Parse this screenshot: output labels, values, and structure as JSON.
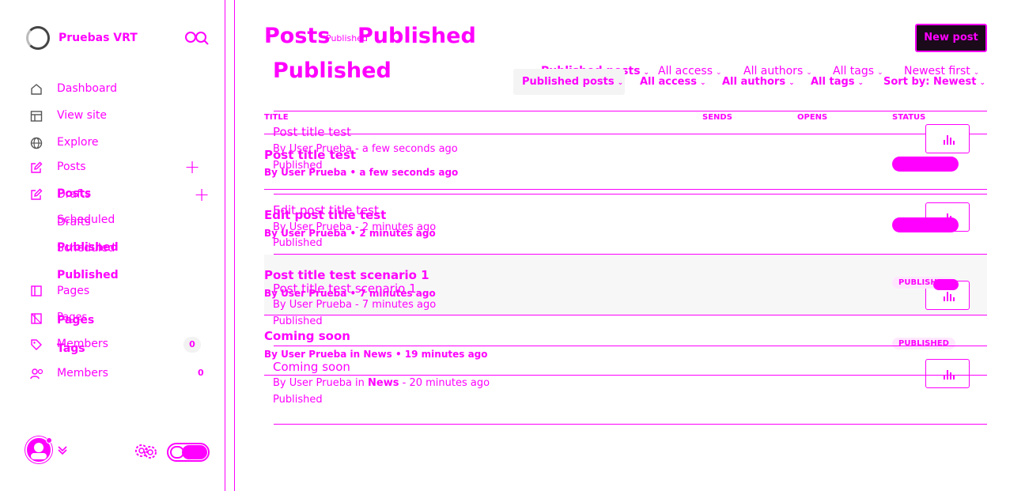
{
  "app": {
    "site_name": "Pruebas VRT",
    "brand_color": "#ff00ff"
  },
  "sidebar": {
    "items": [
      {
        "label": "Dashboard",
        "icon": "home-icon"
      },
      {
        "label": "View site",
        "icon": "browser-icon"
      },
      {
        "label": "Explore",
        "icon": "globe-icon"
      },
      {
        "label": "Posts",
        "icon": "edit-icon"
      },
      {
        "label": "Posts",
        "icon": "edit-icon"
      }
    ],
    "sub_items": [
      "Drafts",
      "Drafts",
      "Scheduled",
      "Scheduled",
      "Published",
      "Published",
      "Published"
    ],
    "pages_label": "Pages",
    "pages_label_2": "Pages",
    "pages_label_3": "Pages",
    "tags_label": "Tags",
    "members_label": "Members",
    "members_label_2": "Members",
    "members_count": "0",
    "members_count_2": "0"
  },
  "header": {
    "title_a": "Posts",
    "title_sub": "Published",
    "title_b": "Published",
    "title_c": "Published",
    "new_post": "New post"
  },
  "filters": {
    "row1": [
      "Published posts",
      "All access",
      "All authors",
      "All tags",
      "Newest first"
    ],
    "row2": [
      "Published posts",
      "All access",
      "All authors",
      "All tags",
      "Sort by: Newest"
    ]
  },
  "table": {
    "columns": [
      "TITLE",
      "SENDS",
      "OPENS",
      "STATUS"
    ]
  },
  "posts": [
    {
      "title": "Post title test",
      "by": "By User Prueba - a few seconds ago",
      "status": "Published"
    },
    {
      "title": "Edit post title test",
      "by": "By User Prueba - 2 minutes ago",
      "status": "Published"
    },
    {
      "title": "Post title test scenario 1",
      "by": "By User Prueba - 7 minutes ago",
      "status": "Published"
    },
    {
      "title": "Coming soon",
      "by_prefix": "By User Prueba in ",
      "tag": "News",
      "by_suffix": " - 20 minutes ago",
      "status": "Published"
    }
  ],
  "posts_alt": [
    {
      "title": "Post title test",
      "by": "By User Prueba • a few seconds ago"
    },
    {
      "title": "Edit post title test",
      "by": "By User Prueba • 2 minutes ago"
    },
    {
      "title": "Post title test scenario 1",
      "by": "By User Prueba • 7 minutes ago",
      "chip": "PUBLISHED"
    },
    {
      "title": "Coming soon",
      "by": "By User Prueba in News • 19 minutes ago",
      "chip": "PUBLISHED"
    }
  ]
}
